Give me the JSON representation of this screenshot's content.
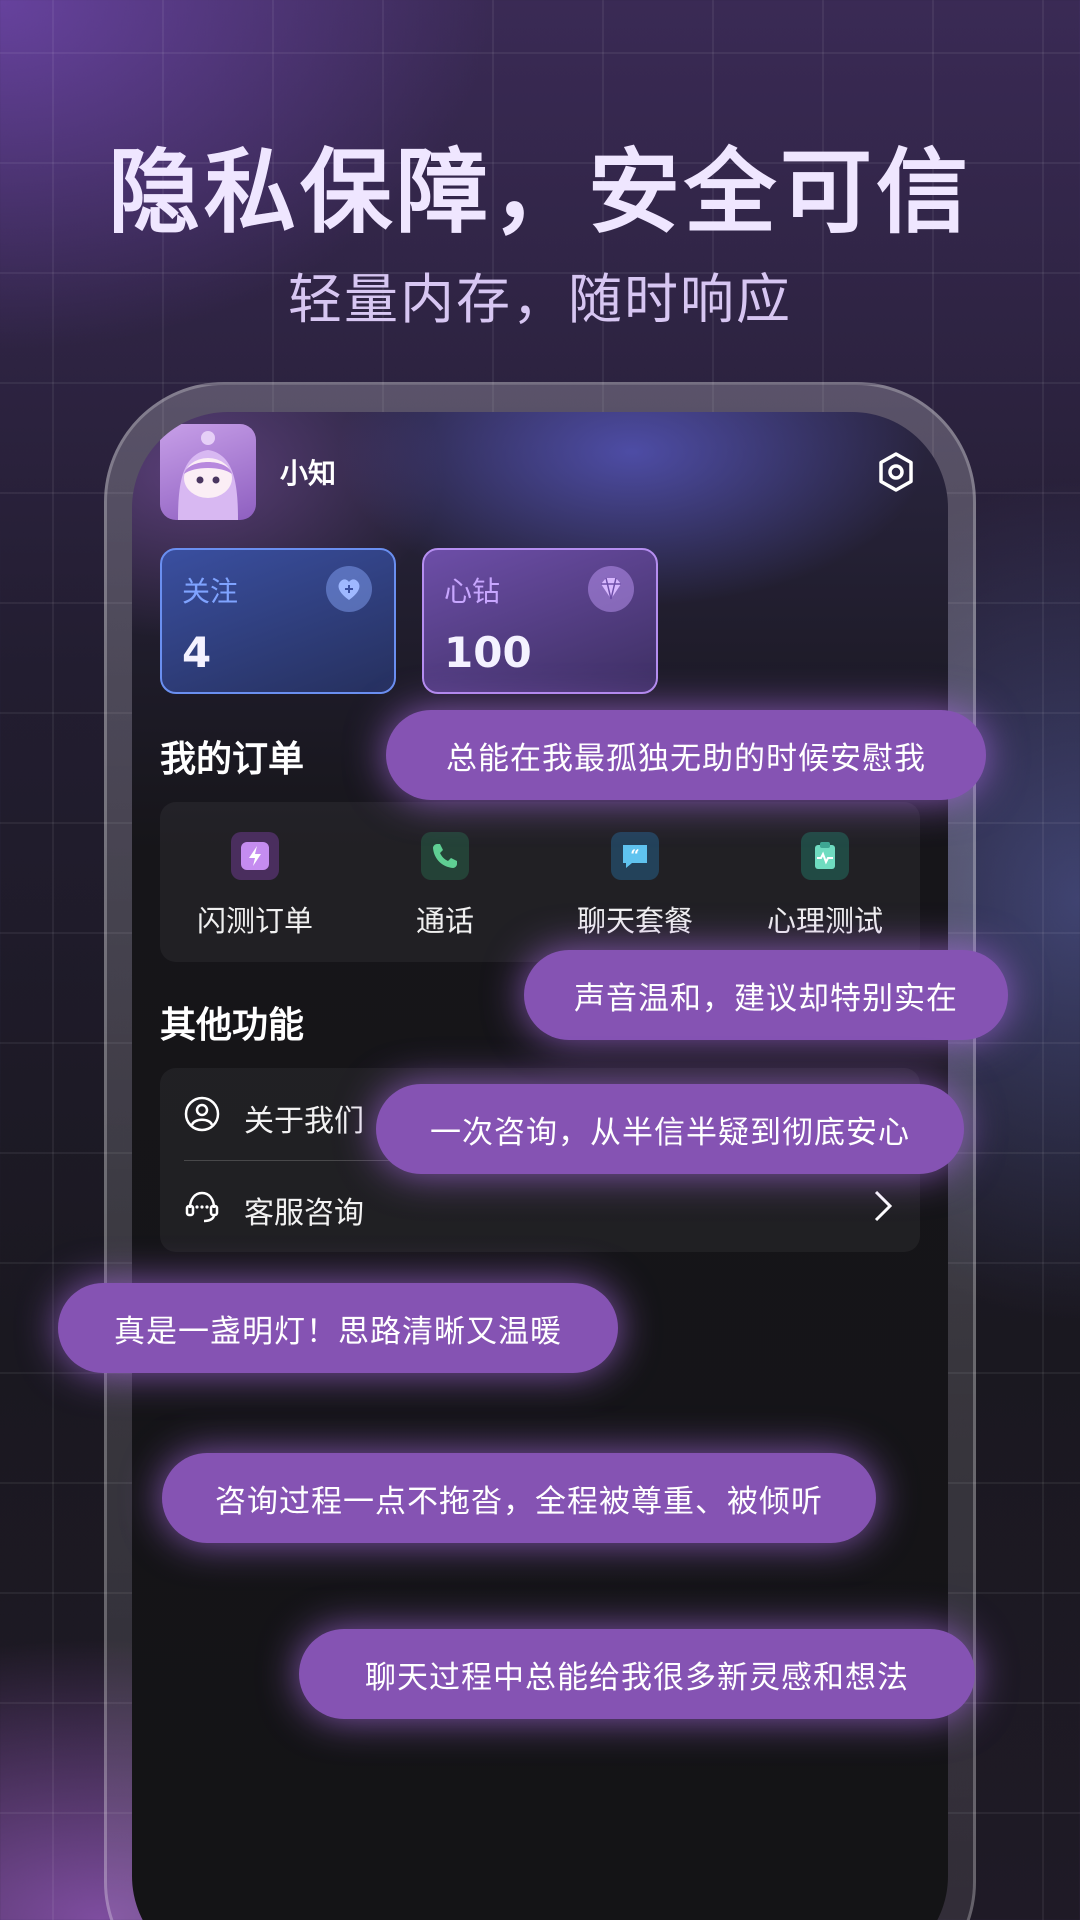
{
  "headline": "隐私保障，安全可信",
  "subheadline": "轻量内存，随时响应",
  "profile": {
    "username": "小知"
  },
  "stats": {
    "follow": {
      "label": "关注",
      "value": "4"
    },
    "diamonds": {
      "label": "心钻",
      "value": "100"
    }
  },
  "orders": {
    "title": "我的订单",
    "items": [
      {
        "label": "闪测订单",
        "icon": "lightning-icon"
      },
      {
        "label": "通话",
        "icon": "phone-icon"
      },
      {
        "label": "聊天套餐",
        "icon": "quote-chat-icon"
      },
      {
        "label": "心理测试",
        "icon": "clipboard-heartbeat-icon"
      }
    ]
  },
  "functions": {
    "title": "其他功能",
    "items": [
      {
        "label": "关于我们",
        "icon": "user-circle-icon"
      },
      {
        "label": "客服咨询",
        "icon": "headset-icon"
      }
    ]
  },
  "testimonials": [
    "总能在我最孤独无助的时候安慰我",
    "声音温和，建议却特别实在",
    "一次咨询，从半信半疑到彻底安心",
    "真是一盏明灯！思路清晰又温暖",
    "咨询过程一点不拖沓，全程被尊重、被倾听",
    "聊天过程中总能给我很多新灵感和想法"
  ],
  "colors": {
    "accent_purple": "#8553b3",
    "follow_blue": "#6a8ff0",
    "diamond_purple": "#b58ef0"
  }
}
